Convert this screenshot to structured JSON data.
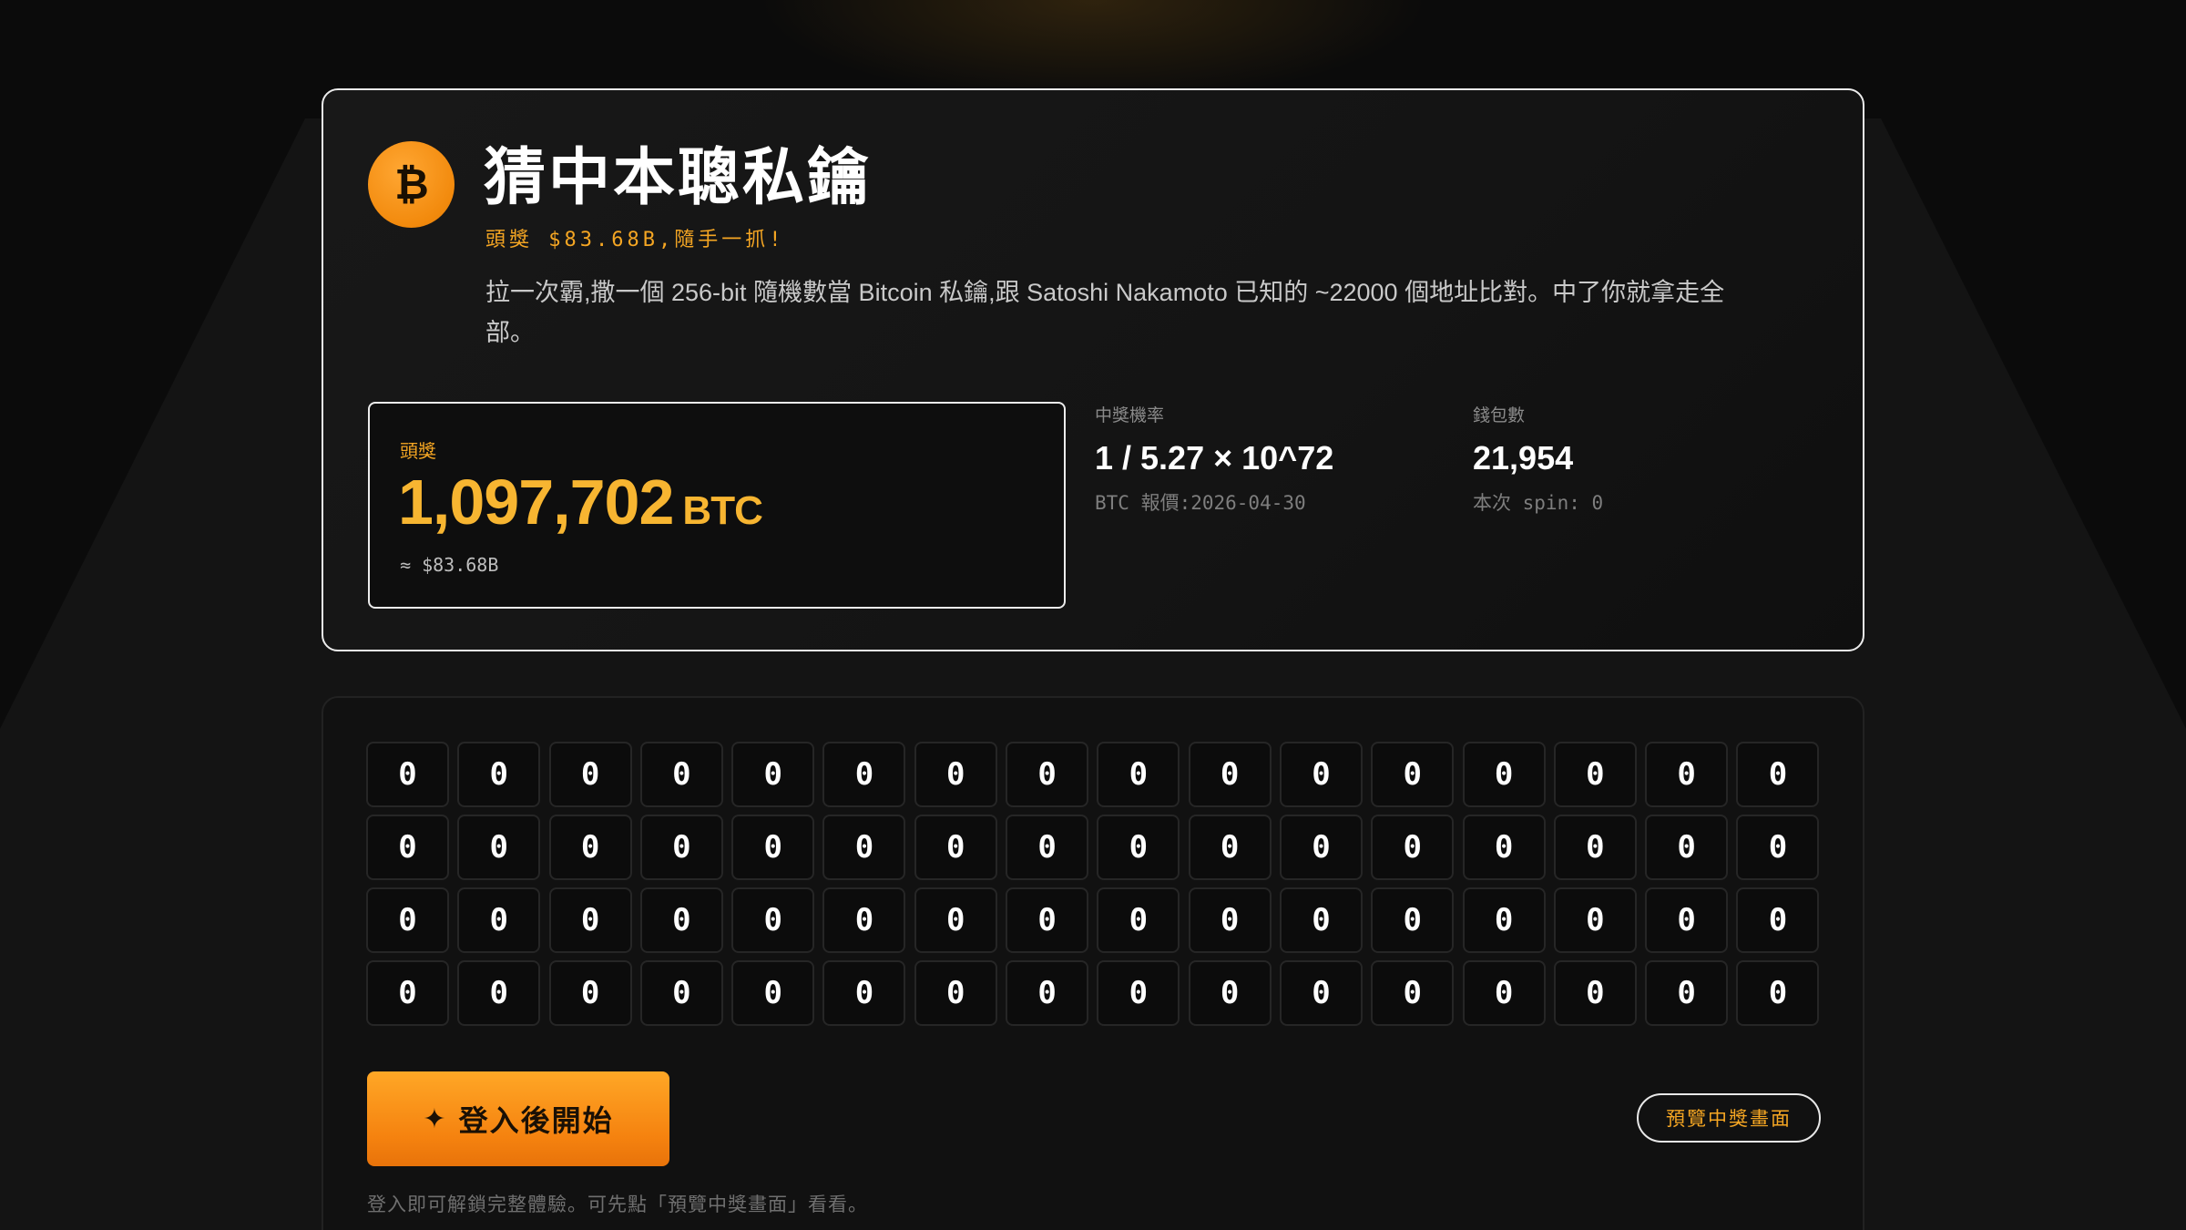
{
  "header": {
    "title": "猜中本聰私鑰",
    "tagline": "頭獎 $83.68B,隨手一抓!",
    "description": "拉一次霸,撒一個 256-bit 隨機數當 Bitcoin 私鑰,跟 Satoshi Nakamoto 已知的 ~22000 個地址比對。中了你就拿走全部。",
    "logo_icon": "bitcoin-icon",
    "logo_glyph": "₿"
  },
  "jackpot": {
    "label": "頭獎",
    "amount": "1,097,702",
    "unit": "BTC",
    "usd": "≈ $83.68B"
  },
  "odds": {
    "label": "中獎機率",
    "value": "1 / 5.27 × 10^72",
    "sub": "BTC 報價:2026-04-30"
  },
  "wallets": {
    "label": "錢包數",
    "value": "21,954",
    "sub": "本次 spin: 0"
  },
  "grid": {
    "rows": [
      [
        "0",
        "0",
        "0",
        "0",
        "0",
        "0",
        "0",
        "0",
        "0",
        "0",
        "0",
        "0",
        "0",
        "0",
        "0",
        "0"
      ],
      [
        "0",
        "0",
        "0",
        "0",
        "0",
        "0",
        "0",
        "0",
        "0",
        "0",
        "0",
        "0",
        "0",
        "0",
        "0",
        "0"
      ],
      [
        "0",
        "0",
        "0",
        "0",
        "0",
        "0",
        "0",
        "0",
        "0",
        "0",
        "0",
        "0",
        "0",
        "0",
        "0",
        "0"
      ],
      [
        "0",
        "0",
        "0",
        "0",
        "0",
        "0",
        "0",
        "0",
        "0",
        "0",
        "0",
        "0",
        "0",
        "0",
        "0",
        "0"
      ]
    ]
  },
  "actions": {
    "start_label": "登入後開始",
    "start_icon": "sparkle-icon",
    "preview_label": "預覽中獎畫面",
    "hint": "登入即可解鎖完整體驗。可先點「預覽中獎畫面」看看。"
  },
  "colors": {
    "accent": "#f5a623",
    "jackpot": "#f7b531",
    "bitcoin": "#f28a0d"
  }
}
